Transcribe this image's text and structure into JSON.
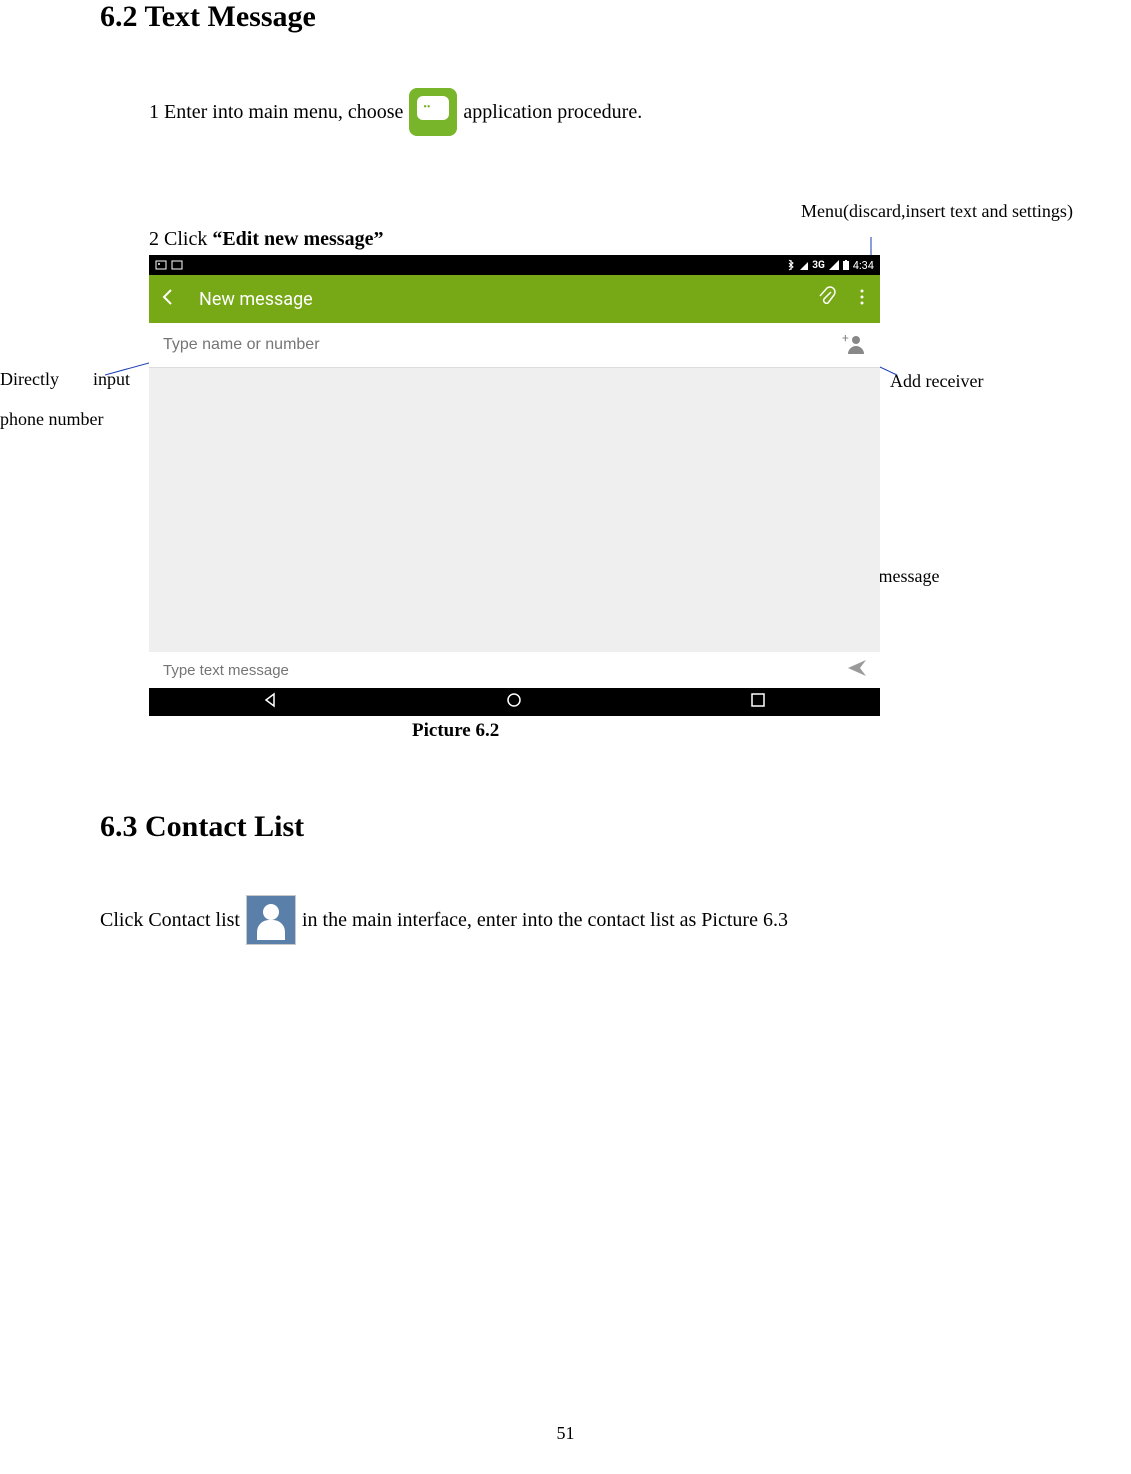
{
  "section1": {
    "heading": "6.2  Text Message",
    "step1_pre": "1 Enter into main menu, choose ",
    "step1_post": " application procedure.",
    "step2_pre": "2 Click ",
    "step2_bold": "“Edit new message”",
    "caption": "Picture 6.2"
  },
  "callouts": {
    "left": "Directly input phone number",
    "menu": "Menu(discard,insert text and settings)",
    "add": "Add receiver",
    "send": "Send message"
  },
  "screenshot": {
    "status_time": "4:34",
    "status_net": "3G",
    "appbar_title": "New message",
    "recipient_placeholder": "Type name or number",
    "compose_placeholder": "Type text message"
  },
  "section2": {
    "heading": "6.3  Contact List",
    "line_pre": "Click Contact list ",
    "line_post": " in the main interface, enter into the contact list as Picture 6.3"
  },
  "page_number": "51"
}
